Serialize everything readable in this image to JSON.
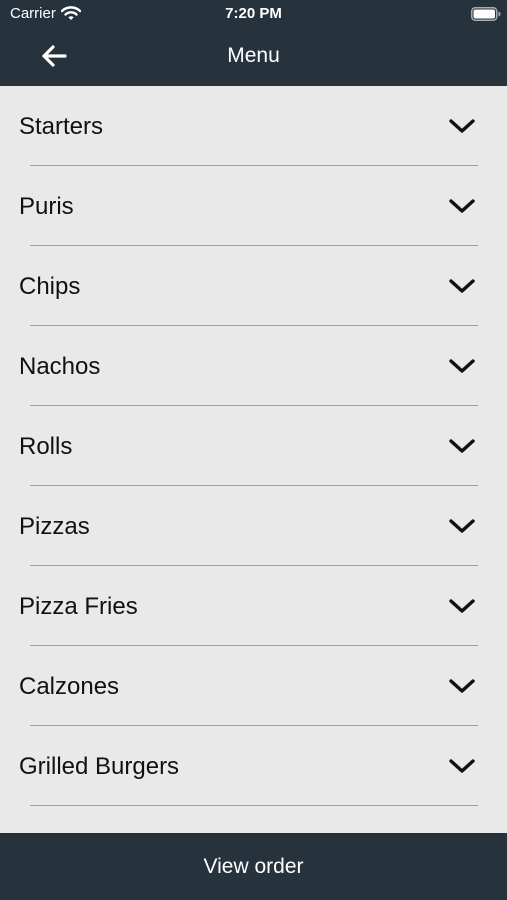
{
  "status_bar": {
    "carrier": "Carrier",
    "time": "7:20 PM",
    "wifi_icon": "wifi-icon",
    "battery_icon": "battery-icon"
  },
  "nav": {
    "title": "Menu",
    "back_icon": "arrow-left-icon"
  },
  "menu": {
    "expand_icon": "chevron-down-icon",
    "items": [
      {
        "label": "Starters"
      },
      {
        "label": "Puris"
      },
      {
        "label": "Chips"
      },
      {
        "label": "Nachos"
      },
      {
        "label": "Rolls"
      },
      {
        "label": "Pizzas"
      },
      {
        "label": "Pizza Fries"
      },
      {
        "label": "Calzones"
      },
      {
        "label": "Grilled Burgers"
      }
    ]
  },
  "footer": {
    "view_order_label": "View order"
  },
  "colors": {
    "bar_background": "#26323c",
    "list_background": "#e9e9e9",
    "divider": "#9e9e9e",
    "bar_text": "#ffffff",
    "list_text": "#111111"
  }
}
